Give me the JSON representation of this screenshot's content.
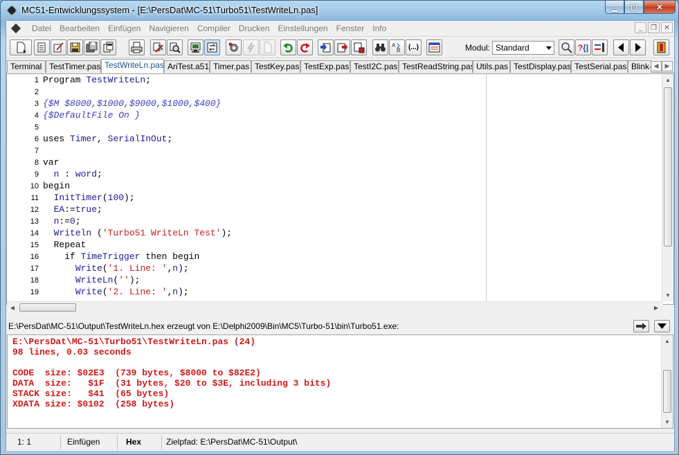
{
  "window": {
    "title": "MC51-Entwicklungssystem - [E:\\PersDat\\MC-51\\Turbo51\\TestWriteLn.pas]"
  },
  "menu": {
    "items": [
      "Datei",
      "Bearbeiten",
      "Einfügen",
      "Navigieren",
      "Compiler",
      "Drucken",
      "Einstellungen",
      "Fenster",
      "Info"
    ]
  },
  "toolbar": {
    "modul_label": "Modul:",
    "modul_value": "Standard",
    "help_button": "?",
    "ellipsis_button": "(...)"
  },
  "tabs": [
    {
      "label": "Terminal",
      "active": false
    },
    {
      "label": "TestTimer.pas",
      "active": false
    },
    {
      "label": "TestWriteLn.pas",
      "active": true
    },
    {
      "label": "AriTest.a51",
      "active": false
    },
    {
      "label": "Timer.pas",
      "active": false
    },
    {
      "label": "TestKey.pas",
      "active": false
    },
    {
      "label": "TestExp.pas",
      "active": false
    },
    {
      "label": "TestI2C.pas",
      "active": false
    },
    {
      "label": "TestReadString.pas",
      "active": false
    },
    {
      "label": "Utils.pas",
      "active": false
    },
    {
      "label": "TestDisplay.pas",
      "active": false
    },
    {
      "label": "TestSerial.pas",
      "active": false
    },
    {
      "label": "Blink-",
      "active": false
    }
  ],
  "editor": {
    "lines": [
      {
        "n": "1",
        "parts": [
          [
            "kw",
            "Program "
          ],
          [
            "id",
            "TestWriteLn"
          ],
          [
            "kw",
            ";"
          ]
        ]
      },
      {
        "n": "2",
        "parts": []
      },
      {
        "n": "3",
        "parts": [
          [
            "cm",
            "{$M $8000,$1000,$9000,$1000,$400}"
          ]
        ]
      },
      {
        "n": "4",
        "parts": [
          [
            "cm",
            "{$DefaultFile On }"
          ]
        ]
      },
      {
        "n": "5",
        "parts": []
      },
      {
        "n": "6",
        "parts": [
          [
            "kw",
            "uses "
          ],
          [
            "id",
            "Timer"
          ],
          [
            "kw",
            ", "
          ],
          [
            "id",
            "SerialInOut"
          ],
          [
            "kw",
            ";"
          ]
        ]
      },
      {
        "n": "7",
        "parts": []
      },
      {
        "n": "8",
        "parts": [
          [
            "kw",
            "var"
          ]
        ]
      },
      {
        "n": "9",
        "parts": [
          [
            "kw",
            "  "
          ],
          [
            "id",
            "n"
          ],
          [
            "kw",
            " : "
          ],
          [
            "id",
            "word"
          ],
          [
            "kw",
            ";"
          ]
        ]
      },
      {
        "n": "10",
        "parts": [
          [
            "kw",
            "begin"
          ]
        ]
      },
      {
        "n": "11",
        "parts": [
          [
            "kw",
            "  "
          ],
          [
            "id",
            "InitTimer"
          ],
          [
            "kw",
            "("
          ],
          [
            "nm",
            "100"
          ],
          [
            "kw",
            ");"
          ]
        ]
      },
      {
        "n": "12",
        "parts": [
          [
            "kw",
            "  "
          ],
          [
            "id",
            "EA"
          ],
          [
            "kw",
            ":="
          ],
          [
            "id",
            "true"
          ],
          [
            "kw",
            ";"
          ]
        ]
      },
      {
        "n": "13",
        "parts": [
          [
            "kw",
            "  "
          ],
          [
            "id",
            "n"
          ],
          [
            "kw",
            ":="
          ],
          [
            "nm",
            "0"
          ],
          [
            "kw",
            ";"
          ]
        ]
      },
      {
        "n": "14",
        "parts": [
          [
            "kw",
            "  "
          ],
          [
            "id",
            "Writeln"
          ],
          [
            "kw",
            " ("
          ],
          [
            "st",
            "'Turbo51 WriteLn Test'"
          ],
          [
            "kw",
            ");"
          ]
        ]
      },
      {
        "n": "15",
        "parts": [
          [
            "kw",
            "  Repeat"
          ]
        ]
      },
      {
        "n": "16",
        "parts": [
          [
            "kw",
            "    if "
          ],
          [
            "id",
            "TimeTrigger"
          ],
          [
            "kw",
            " then begin"
          ]
        ]
      },
      {
        "n": "17",
        "parts": [
          [
            "kw",
            "      "
          ],
          [
            "id",
            "Write"
          ],
          [
            "kw",
            "("
          ],
          [
            "st",
            "'1. Line: '"
          ],
          [
            "kw",
            ","
          ],
          [
            "id",
            "n"
          ],
          [
            "kw",
            ");"
          ]
        ]
      },
      {
        "n": "18",
        "parts": [
          [
            "kw",
            "      "
          ],
          [
            "id",
            "WriteLn"
          ],
          [
            "kw",
            "("
          ],
          [
            "st",
            "''"
          ],
          [
            "kw",
            ");"
          ]
        ]
      },
      {
        "n": "19",
        "parts": [
          [
            "kw",
            "      "
          ],
          [
            "id",
            "Write"
          ],
          [
            "kw",
            "("
          ],
          [
            "st",
            "'2. Line: '"
          ],
          [
            "kw",
            ","
          ],
          [
            "id",
            "n"
          ],
          [
            "kw",
            ");"
          ]
        ]
      }
    ]
  },
  "output": {
    "header_path": "E:\\PersDat\\MC-51\\Output\\TestWriteLn.hex erzeugt von E:\\Delphi2009\\Bin\\MC5\\Turbo-51\\bin\\Turbo51.exe:",
    "lines": [
      "E:\\PersDat\\MC-51\\Turbo51\\TestWriteLn.pas (24)",
      "98 lines, 0.03 seconds",
      "",
      "CODE  size: $02E3  (739 bytes, $8000 to $82E2)",
      "DATA  size:   $1F  (31 bytes, $20 to $3E, including 3 bits)",
      "STACK size:   $41  (65 bytes)",
      "XDATA size: $0102  (258 bytes)"
    ]
  },
  "status": {
    "position": "1: 1",
    "mode": "Einfügen",
    "format": "Hex",
    "target": "Zielpfad: E:\\PersDat\\MC-51\\Output\\"
  }
}
